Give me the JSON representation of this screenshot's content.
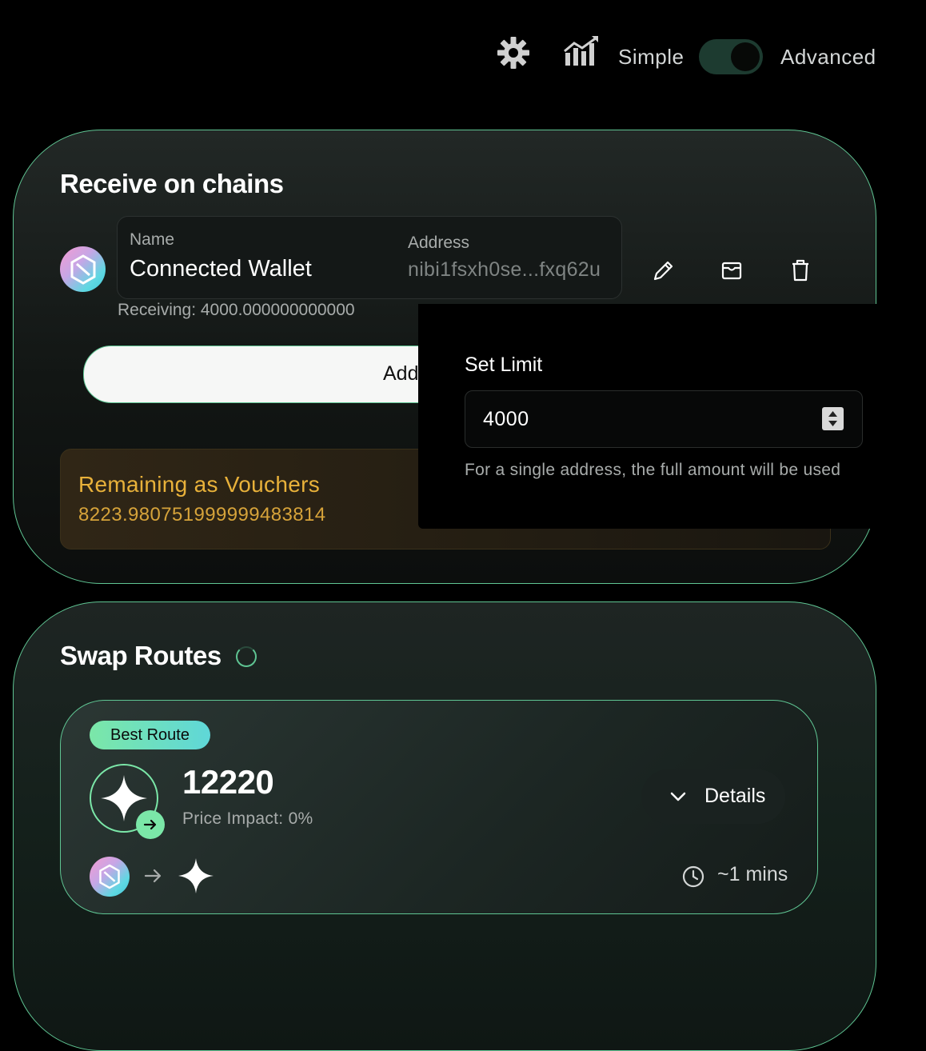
{
  "top_bar": {
    "settings_icon": "gear-icon",
    "chart_icon": "chart-trend-icon",
    "simple_label": "Simple",
    "advanced_label": "Advanced",
    "mode": "advanced"
  },
  "receive": {
    "title": "Receive on chains",
    "wallet": {
      "name_label": "Name",
      "name": "Connected Wallet",
      "address_label": "Address",
      "address": "nibi1fsxh0se...fxq62u"
    },
    "receiving_text": "Receiving: 4000.000000000000",
    "add_button_label": "Add",
    "vouchers_title": "Remaining as Vouchers",
    "vouchers_value": "8223.980751999999483814"
  },
  "set_limit": {
    "title": "Set Limit",
    "value": "4000",
    "hint": "For a single address, the full amount will be used"
  },
  "swap_routes": {
    "title": "Swap Routes",
    "best_route_label": "Best Route",
    "amount": "12220",
    "price_impact": "Price Impact: 0%",
    "details_label": "Details",
    "time": "~1 mins"
  },
  "colors": {
    "accent": "#5fc593",
    "voucher_gold": "#e8b13a",
    "background": "#000000"
  }
}
